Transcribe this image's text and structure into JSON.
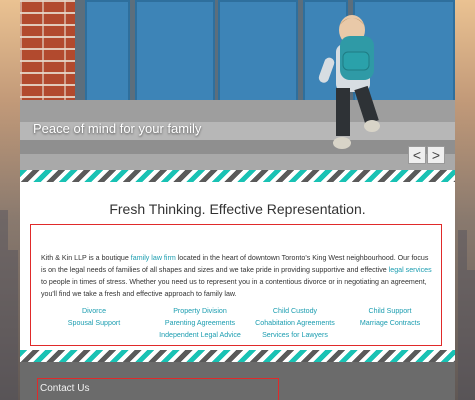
{
  "hero": {
    "caption": "Peace of mind for your family",
    "prev_label": "<",
    "next_label": ">"
  },
  "heading": "Fresh Thinking. Effective Representation.",
  "intro": {
    "part1": "Kith & Kin LLP is a boutique ",
    "link1": "family law firm",
    "part2": " located in the heart of downtown Toronto's King West neighbourhood.  Our focus is on the legal needs of families of all shapes and sizes and we take pride in providing supportive and effective ",
    "link2": "legal services",
    "part3": " to people in times of stress.  Whether you need us to represent you in a contentious divorce or in negotiating an agreement, you'll find we take a fresh and effective approach to family law."
  },
  "practice_links": [
    "Divorce",
    "Property Division",
    "Child Custody",
    "Child Support",
    "Spousal Support",
    "Parenting Agreements",
    "Cohabitation Agreements",
    "Marriage Contracts",
    "Independent Legal Advice",
    "Services for Lawyers"
  ],
  "footer": {
    "contact_title": "Contact Us"
  },
  "colors": {
    "accent_teal": "#1b9db0",
    "stripe_teal": "#19c2b4",
    "highlight_red": "#e02a2a",
    "footer_gray": "#6b6b6b"
  }
}
